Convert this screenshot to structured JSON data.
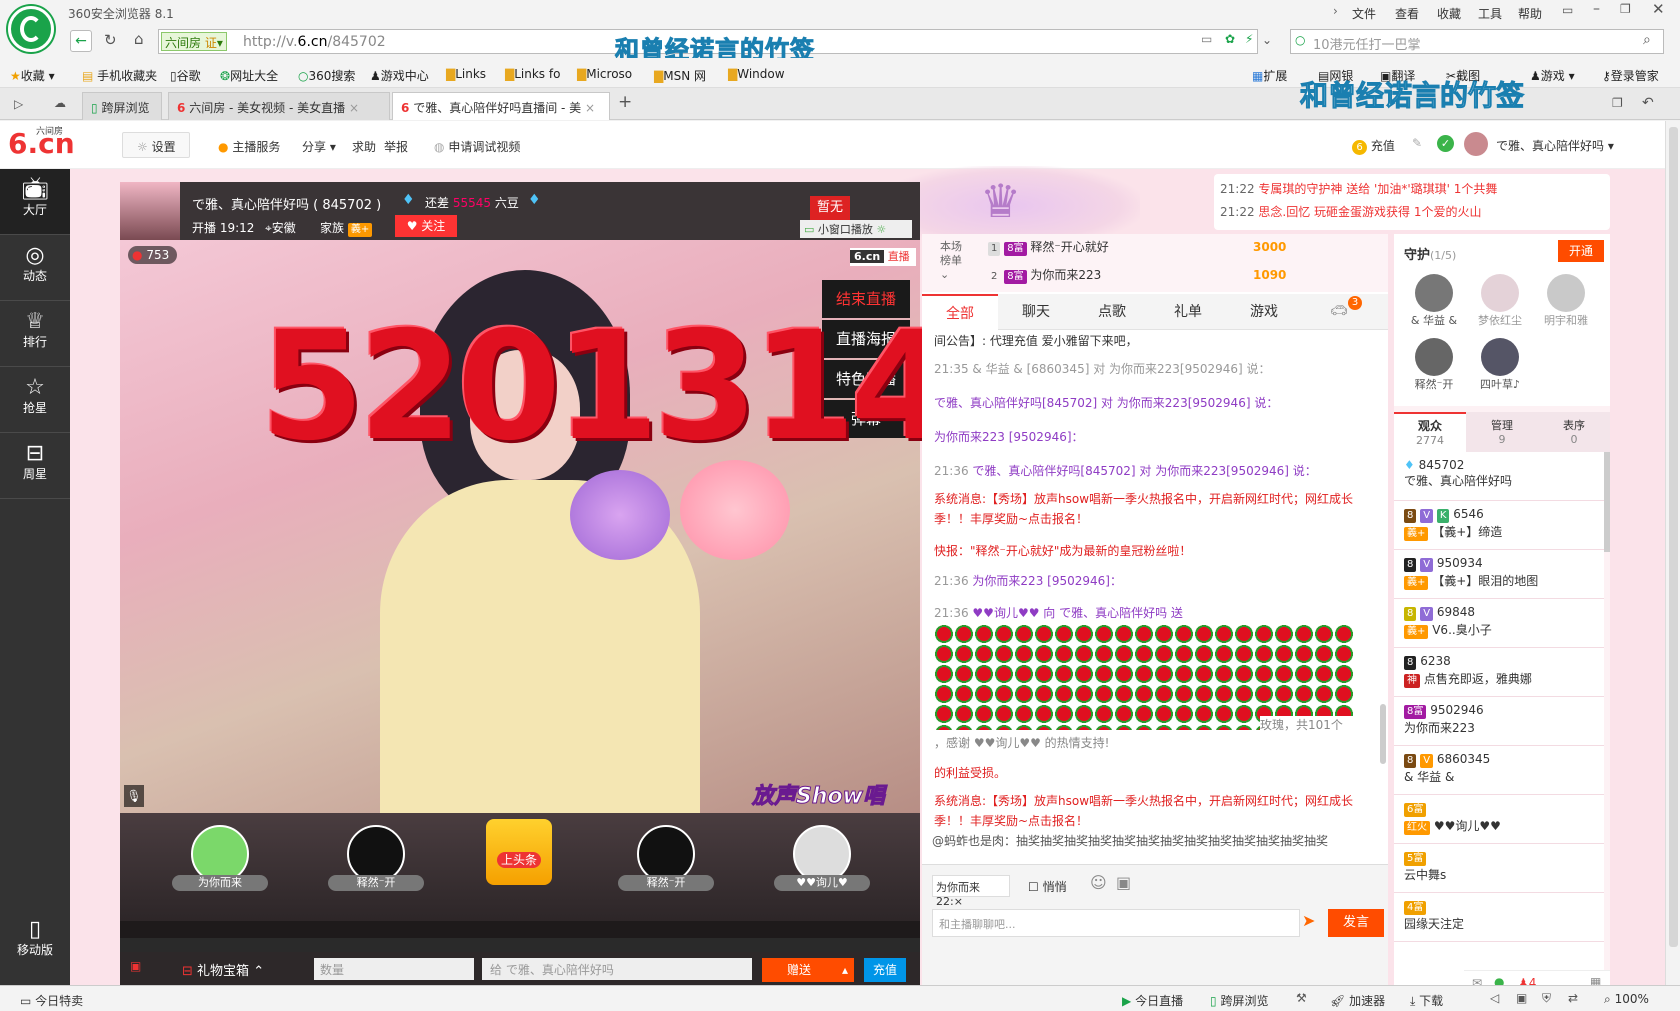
{
  "browser": {
    "title": "360安全浏览器 8.1",
    "menu": [
      "文件",
      "查看",
      "收藏",
      "工具",
      "帮助"
    ],
    "site_label": "六间房",
    "cert_label": "证",
    "url_prefix": "http://v.",
    "url_domain": "6.cn",
    "url_path": "/845702",
    "search_placeholder": "10港元任打一巴掌",
    "overlay_text": "和曾经诺言的竹签",
    "favorites": [
      "收藏",
      "手机收藏夹",
      "谷歌",
      "网址大全",
      "360搜索",
      "游戏中心",
      "Links",
      "Links fo",
      "Microso",
      "MSN 网",
      "Window"
    ],
    "fav_right": [
      "扩展",
      "网银",
      "翻译",
      "截图",
      "游戏",
      "登录管家"
    ],
    "tabs": [
      "跨屏浏览",
      "六间房 - 美女视频 - 美女直播",
      "で雅、真心陪伴好吗直播间 - 美"
    ],
    "status_left": "今日特卖",
    "status_right": [
      "今日直播",
      "跨屏浏览",
      "加速器",
      "下载",
      "100%"
    ]
  },
  "site": {
    "logo": "6.cn",
    "logo_sub": "六间房",
    "nav": [
      "设置",
      "主播服务",
      "分享",
      "求助",
      "举报",
      "申请调试视频"
    ],
    "nav_right": [
      "充值",
      "で雅、真心陪伴好吗"
    ],
    "sidebar": [
      "大厅",
      "动态",
      "排行",
      "抢星",
      "周星",
      "移动版"
    ],
    "host": {
      "name": "で雅、真心陪伴好吗",
      "id": "845702",
      "gap_label": "还差",
      "gap_value": "55545",
      "gap_unit": "六豆",
      "start": "开播 19:12",
      "location": "安徽",
      "family": "家族",
      "family_badge": "義+",
      "follow": "关注",
      "fans": "753"
    },
    "zanwu": "暂无",
    "small_window": "小窗口播放",
    "watermark_logo": "6.cn",
    "watermark_live": "直播",
    "big_number": "5201314",
    "live_menu": [
      "结束直播",
      "直播海报",
      "特色直播",
      "弹幕"
    ],
    "show_logo": "放声Show唱",
    "seats": [
      {
        "name": "为你而来"
      },
      {
        "name": "释然⁻开"
      },
      {
        "name": "上头条"
      },
      {
        "name": "释然⁻开"
      },
      {
        "name": "♥♥询儿♥"
      }
    ],
    "bottom": {
      "treasure": "礼物宝箱",
      "qty_placeholder": "数量",
      "to_label": "给",
      "to_name": "で雅、真心陪伴好吗",
      "send": "赠送",
      "recharge": "充值"
    },
    "notices": [
      {
        "time": "21:22",
        "text": "专属琪的守护神 送给 '加油*'璐琪琪' 1个共舞"
      },
      {
        "time": "21:22",
        "text": "思念.回忆 玩砸金蛋游戏获得 1个爱的火山"
      }
    ],
    "ranking": {
      "title1": "本场",
      "title2": "榜单",
      "items": [
        {
          "rank": "1",
          "name": "释然⁻开心就好",
          "score": "3000"
        },
        {
          "rank": "2",
          "name": "为你而来223",
          "score": "1090"
        }
      ]
    },
    "chat_tabs": [
      "全部",
      "聊天",
      "点歌",
      "礼单",
      "游戏"
    ],
    "chat_tab_badge": "3",
    "chat": [
      {
        "time": "",
        "text": "间公告】: 代理充值 爱小雅留下来吧，"
      },
      {
        "time": "21:35",
        "text": "& 华益 & [6860345] 对 为你而来223[9502946] 说："
      },
      {
        "time": "",
        "text": "で雅、真心陪伴好吗[845702] 对 为你而来223[9502946] 说："
      },
      {
        "time": "",
        "text": "为你而来223 [9502946]："
      },
      {
        "time": "21:36",
        "text": "で雅、真心陪伴好吗[845702] 对 为你而来223[9502946] 说："
      },
      {
        "time": "",
        "text": "系统消息:【秀场】放声hsow唱新一季火热报名中，开启新网红时代；网红成长"
      },
      {
        "time": "",
        "text": "季！！丰厚奖励~点击报名！"
      },
      {
        "time": "",
        "text": "快报：\"释然⁻开心就好\"成为最新的皇冠粉丝啦！"
      },
      {
        "time": "21:36",
        "text": "为你而来223 [9502946]："
      },
      {
        "time": "21:36",
        "text": "♥♥询儿♥♥ 向 で雅、真心陪伴好吗 送"
      }
    ],
    "roses_text": "玫瑰，共101个",
    "thanks_text": "，感谢 ♥♥询儿♥♥ 的热情支持!",
    "chat2": [
      "的利益受损。",
      "系统消息:【秀场】放声hsow唱新一季火热报名中，开启新网红时代；网红成长",
      "季！！丰厚奖励~点击报名！"
    ],
    "marquee": "@蚂蚱也是肉：抽奖抽奖抽奖抽奖抽奖抽奖抽奖抽奖抽奖抽奖抽奖抽奖抽奖",
    "chat_input": {
      "to": "为你而来22:",
      "private": "悄悄",
      "placeholder": "和主播聊聊吧...",
      "send": "发言"
    },
    "guard": {
      "title": "守护",
      "count": "(1/5)",
      "open": "开通",
      "members": [
        "& 华益 &",
        "梦依红尘",
        "明宇和雅",
        "释然⁻开",
        "四叶草♪"
      ]
    },
    "audience_tabs": [
      {
        "label": "观众",
        "count": "2774"
      },
      {
        "label": "管理",
        "count": "9"
      },
      {
        "label": "表序",
        "count": "0"
      }
    ],
    "audience": [
      {
        "id": "845702",
        "name": "で雅、真心陪伴好吗",
        "badge": ""
      },
      {
        "id": "6546",
        "name": "【義+】缔造",
        "badge": "義+"
      },
      {
        "id": "950934",
        "name": "【義+】眼泪的地图",
        "badge": "義+"
      },
      {
        "id": "69848",
        "name": "V6..臭小子",
        "badge": "義+"
      },
      {
        "id": "6238",
        "name": "点售充即返，雅典娜",
        "badge": "神"
      },
      {
        "id": "9502946",
        "name": "为你而来223",
        "badge": ""
      },
      {
        "id": "6860345",
        "name": "& 华益 &",
        "badge": ""
      },
      {
        "id": "",
        "name": "♥♥询儿♥♥",
        "badge": "红火"
      },
      {
        "id": "",
        "name": "云中舞s",
        "badge": ""
      },
      {
        "id": "",
        "name": "园缘天注定",
        "badge": ""
      }
    ],
    "right_bottom_count": "4"
  },
  "colors": {
    "accent": "#ff4c00",
    "pink": "#e8457c",
    "dark": "#2b2b2b",
    "sidebar": "#333333",
    "chat_purple": "#8f3cc4",
    "chat_red": "#e02020"
  }
}
